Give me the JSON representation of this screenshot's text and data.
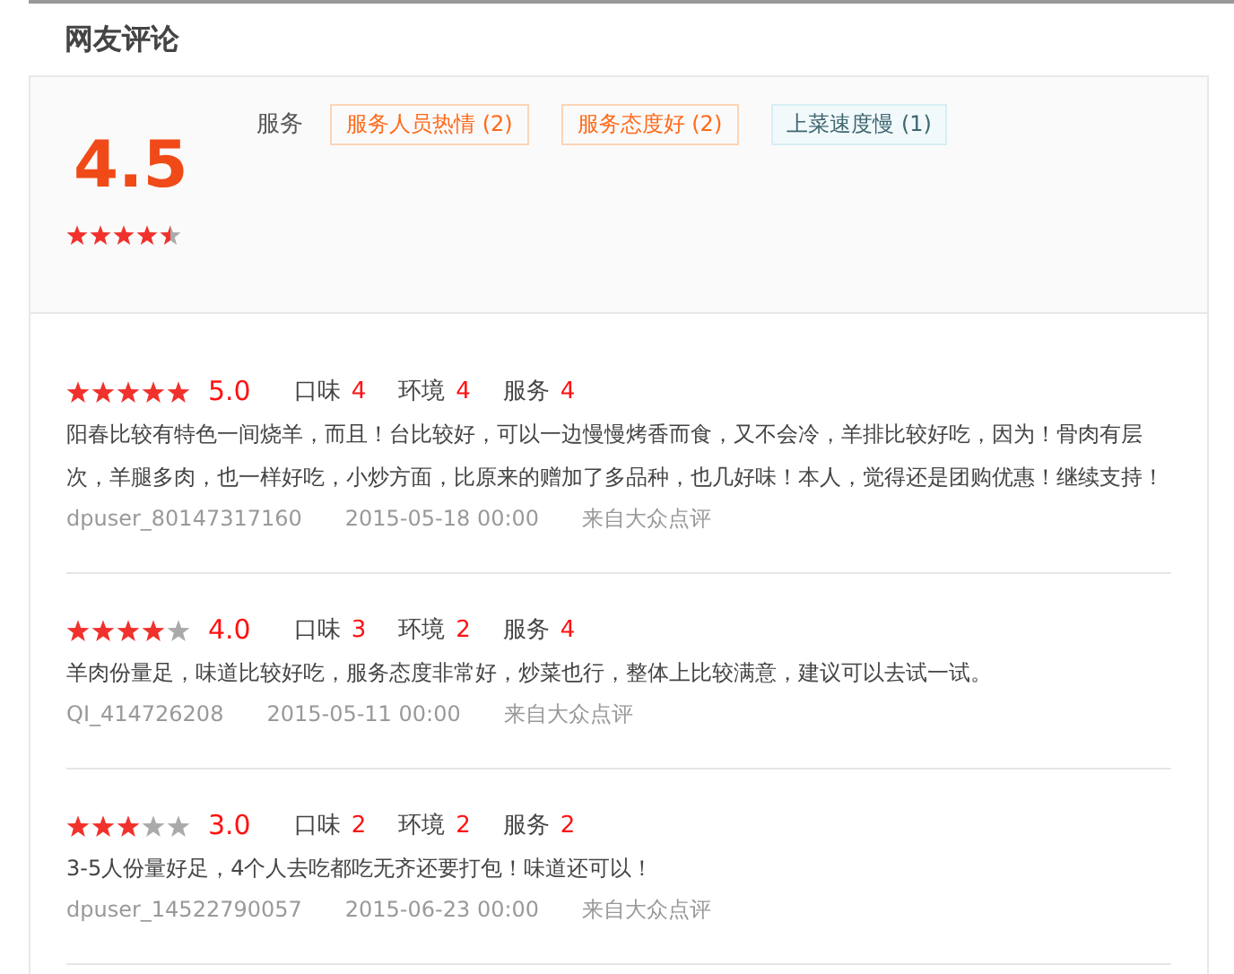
{
  "title": "网友评论",
  "summary": {
    "score": "4.5",
    "stars": 4.5,
    "tag_group": "服务",
    "tags": [
      {
        "label": "服务人员热情 (2)",
        "kind": "positive"
      },
      {
        "label": "服务态度好 (2)",
        "kind": "positive"
      },
      {
        "label": "上菜速度慢 (1)",
        "kind": "negative"
      }
    ]
  },
  "reviews": [
    {
      "stars": 5,
      "score": "5.0",
      "ratings": [
        {
          "label": "口味",
          "value": "4"
        },
        {
          "label": "环境",
          "value": "4"
        },
        {
          "label": "服务",
          "value": "4"
        }
      ],
      "text": "阳春比较有特色一间烧羊，而且！台比较好，可以一边慢慢烤香而食，又不会冷，羊排比较好吃，因为！骨肉有层次，羊腿多肉，也一样好吃，小炒方面，比原来的赠加了多品种，也几好味！本人，觉得还是团购优惠！继续支持！",
      "user": "dpuser_80147317160",
      "date": "2015-05-18 00:00",
      "source": "来自大众点评"
    },
    {
      "stars": 4,
      "score": "4.0",
      "ratings": [
        {
          "label": "口味",
          "value": "3"
        },
        {
          "label": "环境",
          "value": "2"
        },
        {
          "label": "服务",
          "value": "4"
        }
      ],
      "text": "羊肉份量足，味道比较好吃，服务态度非常好，炒菜也行，整体上比较满意，建议可以去试一试。",
      "user": "QI_414726208",
      "date": "2015-05-11 00:00",
      "source": "来自大众点评"
    },
    {
      "stars": 3,
      "score": "3.0",
      "ratings": [
        {
          "label": "口味",
          "value": "2"
        },
        {
          "label": "环境",
          "value": "2"
        },
        {
          "label": "服务",
          "value": "2"
        }
      ],
      "text": "3-5人份量好足，4个人去吃都吃无齐还要打包！味道还可以！",
      "user": "dpuser_14522790057",
      "date": "2015-06-23 00:00",
      "source": "来自大众点评"
    }
  ]
}
